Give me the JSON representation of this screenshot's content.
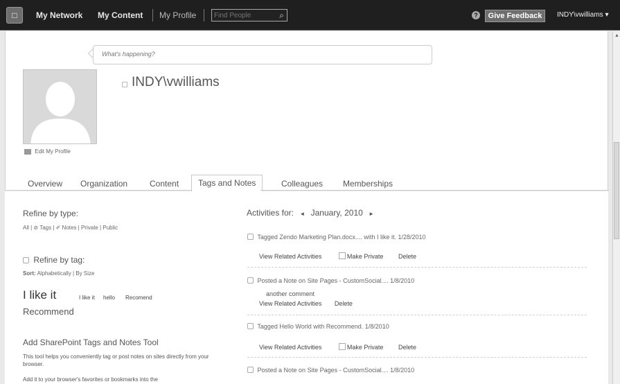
{
  "topbar": {
    "logo_icon": "sharepoint-logo-icon",
    "my_network": "My Network",
    "my_content": "My Content",
    "my_profile": "My Profile",
    "find_people_placeholder": "Find People",
    "search_icon": "search-icon",
    "help_icon": "?",
    "give_feedback": "Give Feedback",
    "user_menu": "INDY\\vwilliams ▾"
  },
  "profile": {
    "status_placeholder": "What's happening?",
    "user_name": "INDY\\vwilliams",
    "edit_profile": "Edit My Profile",
    "tabs": [
      "Overview",
      "Organization",
      "Content",
      "Tags and Notes",
      "Colleagues",
      "Memberships"
    ],
    "active_tab": "Tags and Notes"
  },
  "left": {
    "refine_type_heading": "Refine by type:",
    "type_filters": "All | ⊘ Tags | ✐ Notes | Private | Public",
    "refine_tag_heading": "Refine by tag:",
    "sort_label": "Sort:",
    "sort_options": "Alphabetically | By Size",
    "tag_big": "I like it",
    "tag_small_1": "I like it",
    "tag_small_2": "hello",
    "tag_small_3": "Recomend",
    "tag_medium": "Recommend",
    "tool_heading": "Add SharePoint Tags and Notes Tool",
    "tool_desc_1": "This tool helps you conveniently tag or post notes on sites directly from your browser.",
    "tool_desc_2": "Add it to your browser's favorites or bookmarks into the"
  },
  "activities": {
    "heading": "Activities for:",
    "month": "January, 2010",
    "prev_icon": "◄",
    "next_icon": "►",
    "items": [
      {
        "text": "Tagged Zendo Marketing Plan.docx.... with I like it. 1/28/2010"
      },
      {
        "text": "Posted a Note on Site Pages - CustomSocial.... 1/8/2010",
        "comment": "another comment"
      },
      {
        "text": "Tagged Hello World with Recommend. 1/8/2010"
      },
      {
        "text": "Posted a Note on Site Pages - CustomSocial.... 1/8/2010"
      }
    ],
    "view_related": "View Related Activities",
    "make_private": "Make Private",
    "delete": "Delete"
  }
}
